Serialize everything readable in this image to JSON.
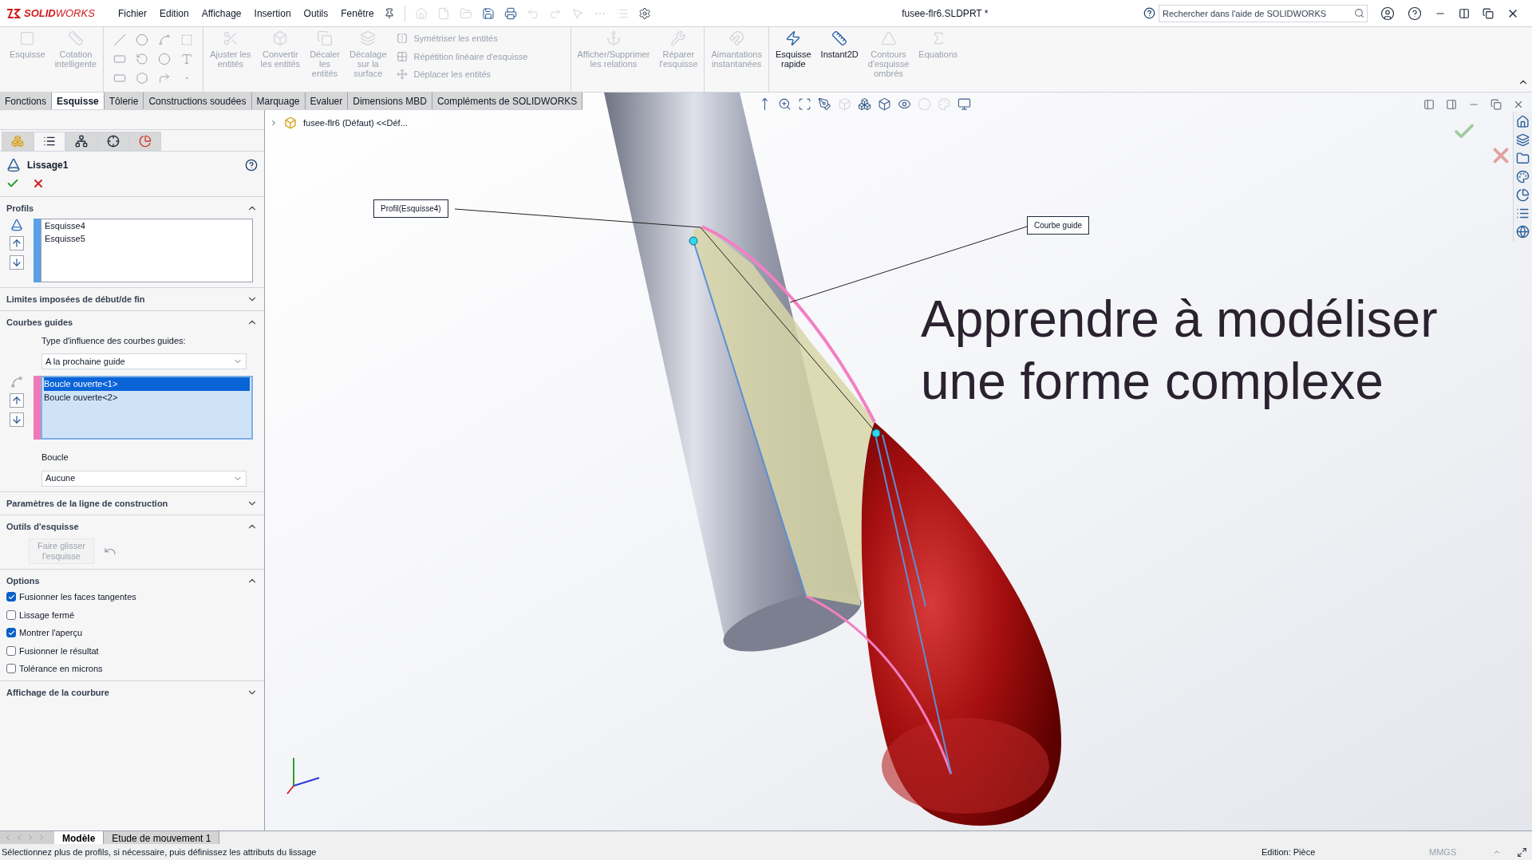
{
  "app": {
    "logo": "**SOLID**WORKS",
    "title": "fusee-flr6.SLDPRT *"
  },
  "menu": [
    "Fichier",
    "Edition",
    "Affichage",
    "Insertion",
    "Outils",
    "Fenêtre"
  ],
  "search": {
    "placeholder": "Rechercher dans l'aide de SOLIDWORKS"
  },
  "ribbon": {
    "groups": [
      [
        {
          "kind": "large",
          "label": "Esquisse",
          "disabled": true
        },
        {
          "kind": "large",
          "label": "Cotation\nintelligente",
          "disabled": true
        }
      ],
      [
        {
          "kind": "grid"
        }
      ],
      [
        {
          "kind": "large",
          "label": "Ajuster les\nentités",
          "disabled": true
        },
        {
          "kind": "large",
          "label": "Convertir\nles entités",
          "disabled": true
        },
        {
          "kind": "large",
          "label": "Décaler\nles\nentités",
          "disabled": true
        },
        {
          "kind": "large",
          "label": "Décalage\nsur la\nsurface",
          "disabled": true
        },
        {
          "kind": "list",
          "items": [
            {
              "label": "Symétriser les entités",
              "disabled": true
            },
            {
              "label": "Répétition linéaire d'esquisse",
              "disabled": true
            },
            {
              "label": "Déplacer les entités",
              "disabled": true
            }
          ]
        }
      ],
      [
        {
          "kind": "large",
          "label": "Afficher/Supprimer\nles relations",
          "disabled": true
        },
        {
          "kind": "large",
          "label": "Réparer\nl'esquisse",
          "disabled": true
        }
      ],
      [
        {
          "kind": "large",
          "label": "Aimantations\ninstantanées",
          "disabled": true
        }
      ],
      [
        {
          "kind": "large",
          "label": "Esquisse\nrapide",
          "disabled": false
        },
        {
          "kind": "large",
          "label": "Instant2D",
          "disabled": false
        },
        {
          "kind": "large",
          "label": "Contours\nd'esquisse\nombrés",
          "disabled": true
        },
        {
          "kind": "large",
          "label": "Equations",
          "disabled": true
        }
      ]
    ]
  },
  "tabs": [
    {
      "label": "Fonctions",
      "selected": false
    },
    {
      "label": "Esquisse",
      "selected": true
    },
    {
      "label": "Tôlerie",
      "selected": false
    },
    {
      "label": "Constructions soudées",
      "selected": false
    },
    {
      "label": "Marquage",
      "selected": false
    },
    {
      "label": "Evaluer",
      "selected": false
    },
    {
      "label": "Dimensions MBD",
      "selected": false
    },
    {
      "label": "Compléments de SOLIDWORKS",
      "selected": false
    }
  ],
  "panel": {
    "tabs": [
      {
        "selected": false
      },
      {
        "selected": true
      },
      {
        "selected": false
      },
      {
        "selected": false
      },
      {
        "selected": false
      }
    ],
    "title": "Lissage1",
    "sections": [
      {
        "kind": "profiles",
        "title": "Profils",
        "expanded": true,
        "items": [
          "Esquisse4",
          "Esquisse5"
        ]
      },
      {
        "kind": "plain",
        "title": "Limites imposées de début/de fin",
        "expanded": false
      },
      {
        "kind": "guides",
        "title": "Courbes guides",
        "expanded": true,
        "type_label": "Type d'influence des courbes guides:",
        "type_value": "A la prochaine guide",
        "items": [
          {
            "label": "Boucle ouverte<1>",
            "selected": true
          },
          {
            "label": "Boucle ouverte<2>",
            "selected": false
          }
        ],
        "loop_label": "Boucle",
        "loop_value": "Aucune"
      },
      {
        "kind": "plain",
        "title": "Paramètres de la ligne de construction",
        "expanded": false
      },
      {
        "kind": "tools",
        "title": "Outils d'esquisse",
        "expanded": true,
        "button": {
          "label": "Faire glisser l'esquisse",
          "disabled": true
        }
      },
      {
        "kind": "options",
        "title": "Options",
        "expanded": true,
        "items": [
          {
            "label": "Fusionner les faces tangentes",
            "checked": true
          },
          {
            "label": "Lissage fermé",
            "checked": false
          },
          {
            "label": "Montrer l'aperçu",
            "checked": true
          },
          {
            "label": "Fusionner le résultat",
            "checked": false
          },
          {
            "label": "Tolérance en microns",
            "checked": false
          }
        ]
      },
      {
        "kind": "plain",
        "title": "Affichage de la courbure",
        "expanded": false
      }
    ]
  },
  "viewport": {
    "tree_node": "fusee-flr6 (Défaut) <<Déf...",
    "callouts": [
      {
        "label": "Profil(Esquisse4)"
      },
      {
        "label": "Courbe guide"
      }
    ],
    "overlay_title": [
      "Apprendre à modéliser",
      "une forme complexe"
    ]
  },
  "bottom_tabs": [
    {
      "label": "Modèle",
      "selected": true
    },
    {
      "label": "Etude de mouvement 1",
      "selected": false
    }
  ],
  "status_bar": {
    "message": "Sélectionnez plus de profils, si nécessaire, puis définissez les attributs du lissage",
    "mode": "Edition: Pièce",
    "units": "MMGS"
  }
}
